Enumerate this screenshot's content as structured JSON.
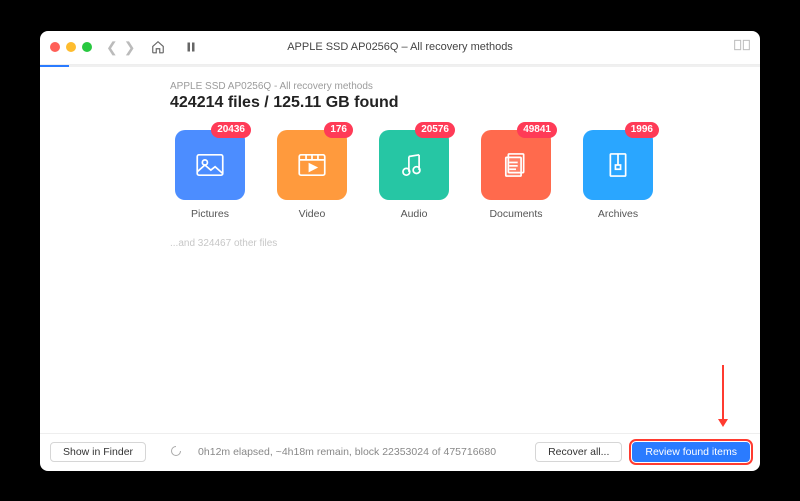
{
  "window": {
    "title": "APPLE SSD AP0256Q – All recovery methods"
  },
  "breadcrumb": "APPLE SSD AP0256Q - All recovery methods",
  "headline": "424214 files / 125.11 GB found",
  "tiles": [
    {
      "label": "Pictures",
      "count": "20436",
      "color": "#4c8dff"
    },
    {
      "label": "Video",
      "count": "176",
      "color": "#ff9a3d"
    },
    {
      "label": "Audio",
      "count": "20576",
      "color": "#26c6a4"
    },
    {
      "label": "Documents",
      "count": "49841",
      "color": "#ff6a4d"
    },
    {
      "label": "Archives",
      "count": "1996",
      "color": "#2aa6ff"
    }
  ],
  "other_files": "...and 324467 other files",
  "footer": {
    "show_in_finder": "Show in Finder",
    "status": "0h12m elapsed, ~4h18m remain, block 22353024 of 475716680",
    "recover_all": "Recover all...",
    "review": "Review found items"
  }
}
